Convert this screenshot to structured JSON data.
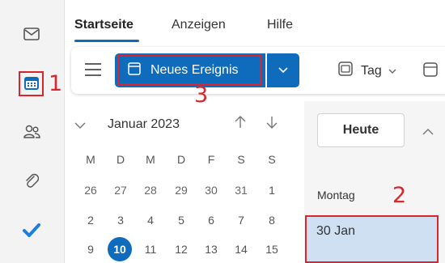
{
  "ribbon": {
    "tabs": [
      {
        "label": "Startseite",
        "active": true
      },
      {
        "label": "Anzeigen",
        "active": false
      },
      {
        "label": "Hilfe",
        "active": false
      }
    ]
  },
  "toolbar": {
    "new_event_label": "Neues Ereignis",
    "view_label": "Tag"
  },
  "rail": {
    "icons": [
      "mail-icon",
      "calendar-icon",
      "people-icon",
      "attachment-icon",
      "todo-check-icon"
    ]
  },
  "mini_calendar": {
    "month_label": "Januar 2023",
    "weekdays": [
      "M",
      "D",
      "M",
      "D",
      "F",
      "S",
      "S"
    ],
    "weeks": [
      [
        "26",
        "27",
        "28",
        "29",
        "30",
        "31",
        "1"
      ],
      [
        "2",
        "3",
        "4",
        "5",
        "6",
        "7",
        "8"
      ],
      [
        "9",
        "10",
        "11",
        "12",
        "13",
        "14",
        "15"
      ]
    ],
    "today": "10"
  },
  "day_view": {
    "today_button": "Heute",
    "weekday_label": "Montag",
    "date_label": "30 Jan"
  },
  "annotations": [
    "1",
    "2",
    "3"
  ],
  "colors": {
    "accent": "#0f6cbd",
    "highlight_red": "#d9262c",
    "selected_cell": "#cfe0f3"
  }
}
